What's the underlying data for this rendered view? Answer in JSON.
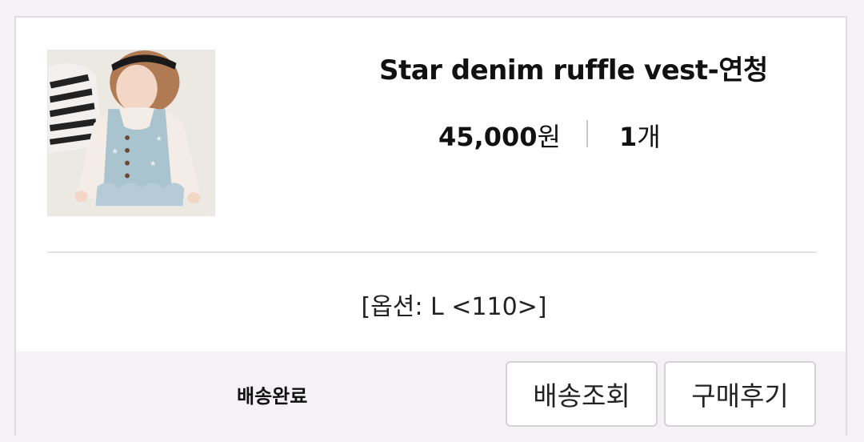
{
  "order_item": {
    "image_alt": "child wearing denim ruffle vest",
    "product_name": "Star denim ruffle vest-연청",
    "price_number": "45,000",
    "price_unit": "원",
    "quantity_number": "1",
    "quantity_unit": "개",
    "option_text": "[옵션: L <110>]",
    "status": "배송완료",
    "buttons": {
      "track_label": "배송조회",
      "review_label": "구매후기"
    }
  }
}
